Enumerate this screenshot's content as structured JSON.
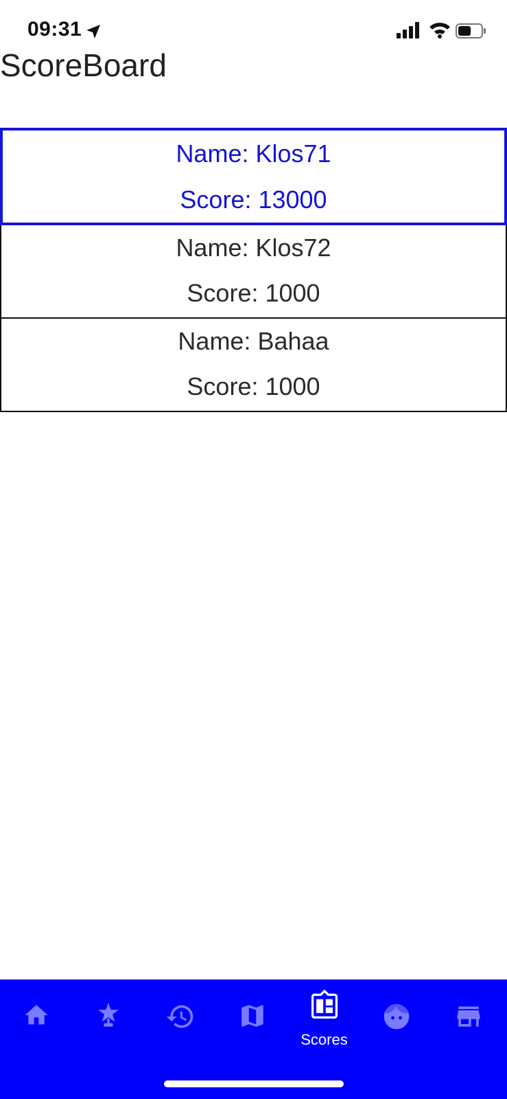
{
  "status": {
    "time": "09:31"
  },
  "page": {
    "title": "ScoreBoard"
  },
  "scores": [
    {
      "name": "Name: Klos71",
      "score": "Score: 13000"
    },
    {
      "name": "Name: Klos72",
      "score": "Score: 1000"
    },
    {
      "name": "Name: Bahaa",
      "score": "Score: 1000"
    }
  ],
  "tabs": [
    {
      "icon": "home-icon"
    },
    {
      "icon": "star-trophy-icon"
    },
    {
      "icon": "history-icon"
    },
    {
      "icon": "map-icon"
    },
    {
      "icon": "scoreboard-icon",
      "label": "Scores",
      "active": true
    },
    {
      "icon": "face-icon"
    },
    {
      "icon": "store-icon"
    }
  ],
  "colors": {
    "accent": "#0000fe",
    "selected_text": "#1414d2",
    "inactive_icon": "#7b7bff",
    "active_icon": "#ffffff"
  }
}
